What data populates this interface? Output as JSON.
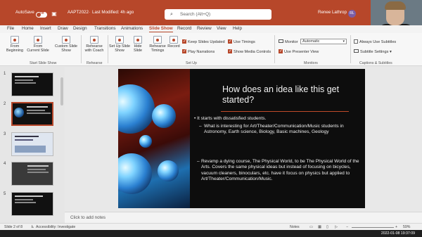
{
  "window": {
    "autosave_label": "AutoSave",
    "autosave_state": "Off",
    "filename": "AAPT2022",
    "last_modified": "Last Modified: 4h ago",
    "search_placeholder": "Search (Alt+Q)",
    "user_name": "Renee Lathrop",
    "user_initials": "RL"
  },
  "webcam": {
    "label": "Renee Lathrop"
  },
  "menu": {
    "tabs": [
      "File",
      "Home",
      "Insert",
      "Draw",
      "Design",
      "Transitions",
      "Animations",
      "Slide Show",
      "Record",
      "Review",
      "View",
      "Help"
    ],
    "active": "Slide Show"
  },
  "ribbon": {
    "start_group": {
      "label": "Start Slide Show",
      "from_beginning": "From Beginning",
      "from_current": "From Current Slide",
      "custom_show": "Custom Slide Show"
    },
    "rehearse_group": {
      "label": "Rehearse",
      "rehearse_with_coach": "Rehearse with Coach"
    },
    "setup_group": {
      "label": "Set Up",
      "setup_show": "Set Up Slide Show",
      "hide_slide": "Hide Slide",
      "rehearse_timings": "Rehearse Timings",
      "record": "Record",
      "keep_slides_updated": "Keep Slides Updated",
      "play_narrations": "Play Narrations",
      "use_timings": "Use Timings",
      "show_media_controls": "Show Media Controls"
    },
    "monitors_group": {
      "label": "Monitors",
      "monitor_label": "Monitor",
      "monitor_value": "Automatic",
      "use_presenter_view": "Use Presenter View"
    },
    "captions_group": {
      "label": "Captions & Subtitles",
      "always_use_subtitles": "Always Use Subtitles",
      "subtitle_settings": "Subtitle Settings"
    }
  },
  "thumbnails": {
    "numbers": [
      "1",
      "2",
      "3",
      "4",
      "5"
    ]
  },
  "slide": {
    "title": "How does an idea like this get started?",
    "bullet1": "It starts with dissatisfied students.",
    "sub1": "What is interesting for Art/Theater/Communication/Music students in Astronomy, Earth science, Biology, Basic machines, Geology",
    "para2": "Revamp a dying course, The Physical World, to be The Physical World of the Arts.  Covers the same physical ideas but instead of focusing on bicycles, vacuum cleaners, binoculars, etc. have it focus on physics but applied to Art/Theater/Communication/Music."
  },
  "notes": {
    "placeholder": "Click to add notes"
  },
  "statusbar": {
    "slide_info": "Slide 2 of 8",
    "accessibility": "Accessibility: Investigate",
    "notes": "Notes",
    "zoom": "59%"
  },
  "taskbar": {
    "datetime": "2022-01-08  19:37:09"
  },
  "colors": {
    "accent": "#b7472a"
  }
}
